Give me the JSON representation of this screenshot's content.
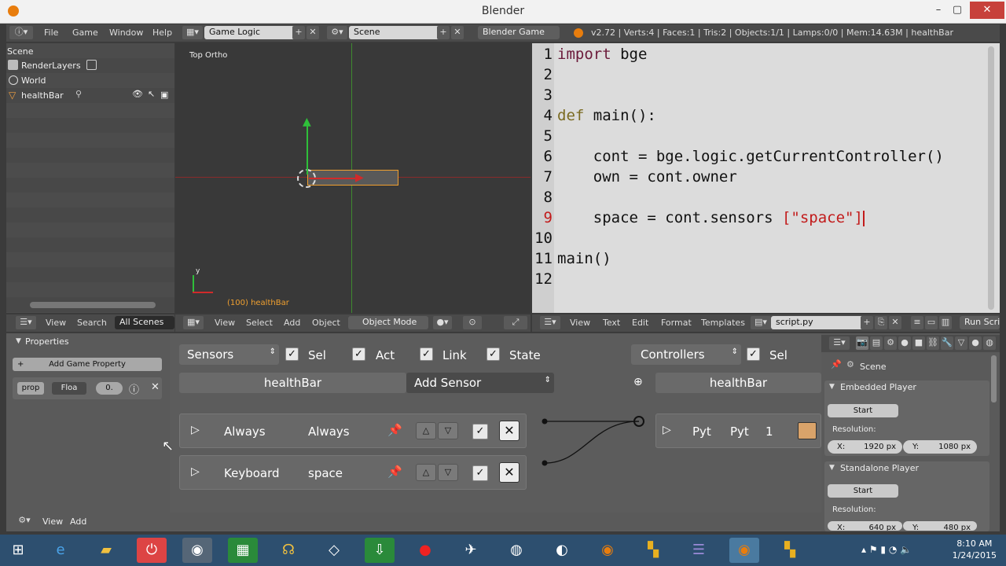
{
  "window": {
    "title": "Blender"
  },
  "infobar": {
    "menus": [
      "File",
      "Game",
      "Window",
      "Help"
    ],
    "screen": "Game Logic",
    "scene": "Scene",
    "engine": "Blender Game",
    "stats": "v2.72 | Verts:4 | Faces:1 | Tris:2 | Objects:1/1 | Lamps:0/0 | Mem:14.63M | healthBar"
  },
  "outliner": {
    "header": "Scene",
    "items": [
      "RenderLayers",
      "World",
      "healthBar"
    ],
    "footer": {
      "view": "View",
      "search": "Search",
      "filter": "All Scenes"
    }
  },
  "viewport": {
    "label": "Top Ortho",
    "object_label": "(100) healthBar",
    "axis_label": "y",
    "footer": {
      "view": "View",
      "select": "Select",
      "add": "Add",
      "object": "Object",
      "mode": "Object Mode"
    }
  },
  "texteditor": {
    "line_numbers": [
      "1",
      "2",
      "3",
      "4",
      "5",
      "6",
      "7",
      "8",
      "9",
      "10",
      "11",
      "12"
    ],
    "footer": {
      "view": "View",
      "text": "Text",
      "edit": "Edit",
      "format": "Format",
      "templates": "Templates",
      "filename": "script.py",
      "run": "Run Script"
    },
    "code": {
      "l1a": "import",
      "l1b": " bge",
      "l4a": "def",
      "l4b": " main():",
      "l6": "    cont = bge.logic.getCurrentController()",
      "l7": "    own = cont.owner",
      "l9a": "    space = cont.sensors ",
      "l9b": "[\"space\"]",
      "l11": "main()"
    }
  },
  "properties": {
    "title": "Properties",
    "add_game_property": "Add Game Property",
    "prop_name": "prop",
    "prop_type": "Floa",
    "prop_value": "0."
  },
  "logic": {
    "sensors": "Sensors",
    "sel": "Sel",
    "act": "Act",
    "link": "Link",
    "state": "State",
    "object": "healthBar",
    "add_sensor": "Add Sensor",
    "controllers": "Controllers",
    "ctrl_sel": "Sel",
    "ctrl_object": "healthBar",
    "sensor_bricks": [
      {
        "type": "Always",
        "name": "Always"
      },
      {
        "type": "Keyboard",
        "name": "space"
      }
    ],
    "controller_brick": {
      "type": "Pyt",
      "name": "Pyt",
      "state": "1"
    },
    "footer": {
      "view": "View",
      "add": "Add"
    }
  },
  "render": {
    "scene": "Scene",
    "embedded": "Embedded Player",
    "start1": "Start",
    "resolution": "Resolution:",
    "x1": "1920 px",
    "y1": "1080 px",
    "standalone": "Standalone Player",
    "start2": "Start",
    "x2": "640 px",
    "y2": "480 px",
    "x_label": "X:",
    "y_label": "Y:"
  },
  "taskbar": {
    "time": "8:10 AM",
    "date": "1/24/2015"
  }
}
